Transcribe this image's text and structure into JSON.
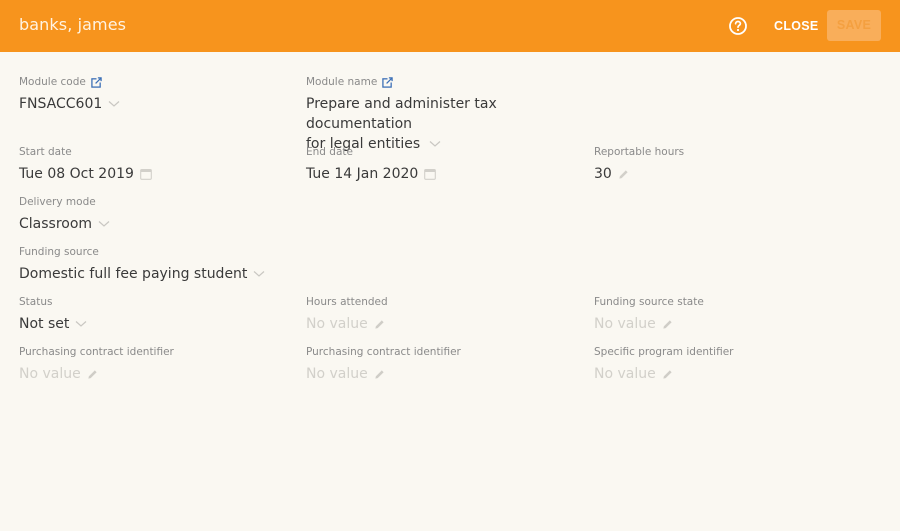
{
  "header": {
    "title": "banks, james",
    "help_icon": "question-circle-icon",
    "close_label": "CLOSE",
    "save_label": "SAVE",
    "colors": {
      "bar": "#f7941d",
      "save_bg": "#f9ae5a"
    }
  },
  "fields": {
    "module_code": {
      "label": "Module code",
      "value": "FNSACC601",
      "label_icon": "external-link-icon",
      "value_icon": "chevron-down-icon"
    },
    "module_name": {
      "label": "Module name",
      "value_line1": "Prepare and administer tax documentation",
      "value_line2": "for legal entities",
      "label_icon": "external-link-icon",
      "value_icon": "chevron-down-icon"
    },
    "start_date": {
      "label": "Start date",
      "value": "Tue 08 Oct 2019",
      "value_icon": "calendar-icon"
    },
    "end_date": {
      "label": "End date",
      "value": "Tue 14 Jan 2020",
      "value_icon": "calendar-icon"
    },
    "reportable_hours": {
      "label": "Reportable hours",
      "value": "30",
      "value_icon": "pencil-icon"
    },
    "delivery_mode": {
      "label": "Delivery mode",
      "value": "Classroom",
      "value_icon": "chevron-down-icon"
    },
    "funding_source": {
      "label": "Funding source",
      "value": "Domestic full fee paying student",
      "value_icon": "chevron-down-icon"
    },
    "status": {
      "label": "Status",
      "value": "Not set",
      "value_icon": "chevron-down-icon"
    },
    "hours_attended": {
      "label": "Hours attended",
      "value": "No value",
      "value_icon": "pencil-icon"
    },
    "funding_source_state": {
      "label": "Funding source state",
      "value": "No value",
      "value_icon": "pencil-icon"
    },
    "purchasing_contract_identifier_1": {
      "label": "Purchasing contract identifier",
      "value": "No value",
      "value_icon": "pencil-icon"
    },
    "purchasing_contract_identifier_2": {
      "label": "Purchasing contract identifier",
      "value": "No value",
      "value_icon": "pencil-icon"
    },
    "specific_program_identifier": {
      "label": "Specific program identifier",
      "value": "No value",
      "value_icon": "pencil-icon"
    }
  },
  "colors": {
    "link_icon": "#3b6fb6",
    "background": "#faf8f2"
  }
}
